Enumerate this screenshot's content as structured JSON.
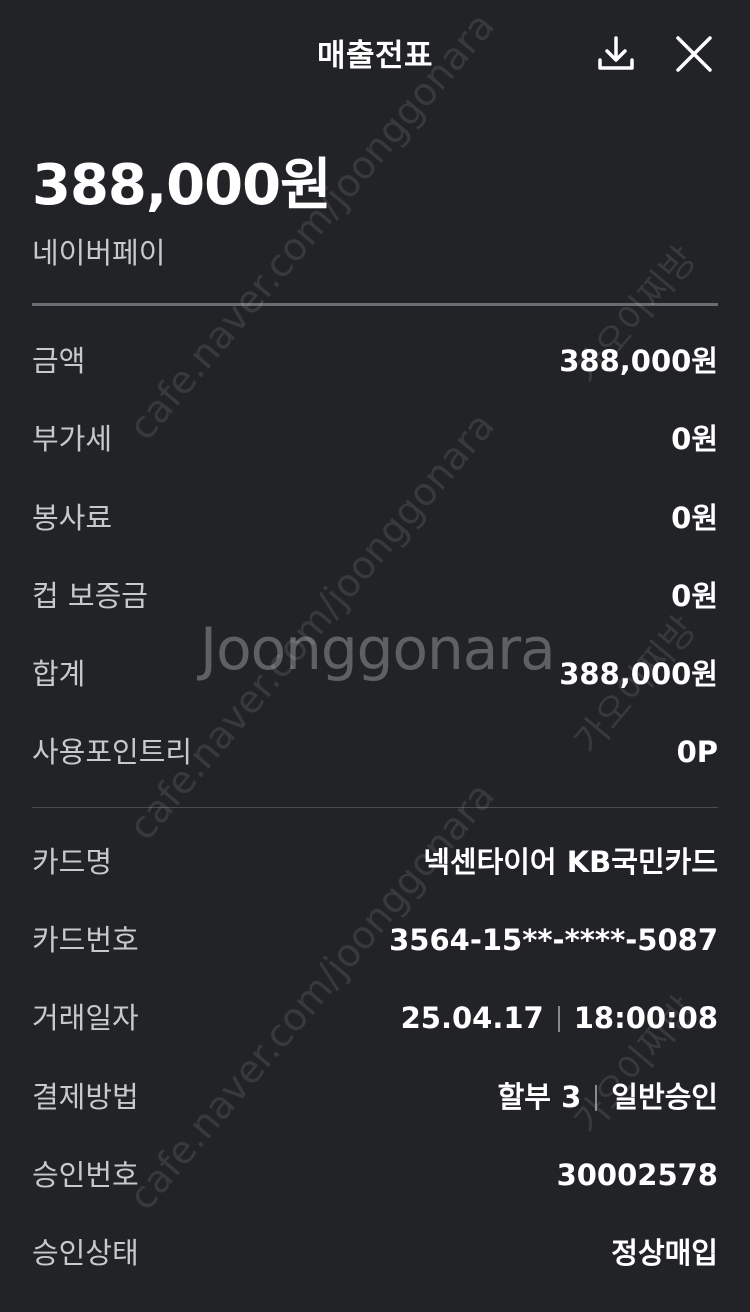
{
  "header": {
    "title": "매출전표",
    "download_icon": "download-icon",
    "close_icon": "close-icon"
  },
  "summary": {
    "amount": "388,000원",
    "pay_method": "네이버페이"
  },
  "amount_rows": [
    {
      "label": "금액",
      "value": "388,000원"
    },
    {
      "label": "부가세",
      "value": "0원"
    },
    {
      "label": "봉사료",
      "value": "0원"
    },
    {
      "label": "컵 보증금",
      "value": "0원"
    },
    {
      "label": "합계",
      "value": "388,000원"
    },
    {
      "label": "사용포인트리",
      "value": "0P"
    }
  ],
  "card_rows": [
    {
      "label": "카드명",
      "value": "넥센타이어 KB국민카드"
    },
    {
      "label": "카드번호",
      "value": "3564-15**-****-5087"
    },
    {
      "label": "거래일자",
      "date": "25.04.17",
      "time": "18:00:08"
    },
    {
      "label": "결제방법",
      "installment": "할부 3",
      "type": "일반승인"
    },
    {
      "label": "승인번호",
      "value": "30002578"
    },
    {
      "label": "승인상태",
      "value": "정상매입"
    }
  ],
  "watermarks": {
    "brand": "Joonggonara",
    "url": "cafe.naver.com/joonggonara",
    "cafe": "가오이찌방"
  },
  "colors": {
    "background": "#222327",
    "text_primary": "#ffffff",
    "text_secondary": "#c8c9cd",
    "divider": "#6b6c71"
  }
}
